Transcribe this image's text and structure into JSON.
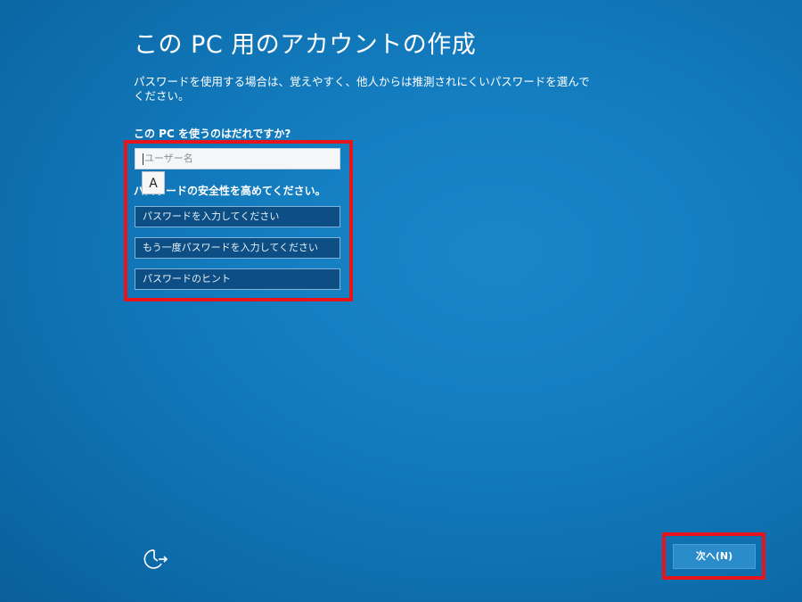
{
  "page": {
    "title": "この PC 用のアカウントの作成",
    "description": "パスワードを使用する場合は、覚えやすく、他人からは推測されにくいパスワードを選んでください。",
    "question_label": "この PC を使うのはだれですか?",
    "security_label": "パスワードの安全性を高めてください。"
  },
  "form": {
    "username": {
      "value": "",
      "placeholder": "ユーザー名"
    },
    "password": {
      "value": "",
      "placeholder": "パスワードを入力してください"
    },
    "password_confirm": {
      "value": "",
      "placeholder": "もう一度パスワードを入力してください"
    },
    "password_hint": {
      "value": "",
      "placeholder": "パスワードのヒント"
    }
  },
  "ime_indicator": {
    "label": "A"
  },
  "footer": {
    "next_button_label": "次へ(N)",
    "ease_of_access_icon": "ease-of-access-icon"
  },
  "colors": {
    "background": "#137dc0",
    "highlight": "#e8141b",
    "field_dark": "#0d4f84",
    "button": "#2b8ccb"
  }
}
